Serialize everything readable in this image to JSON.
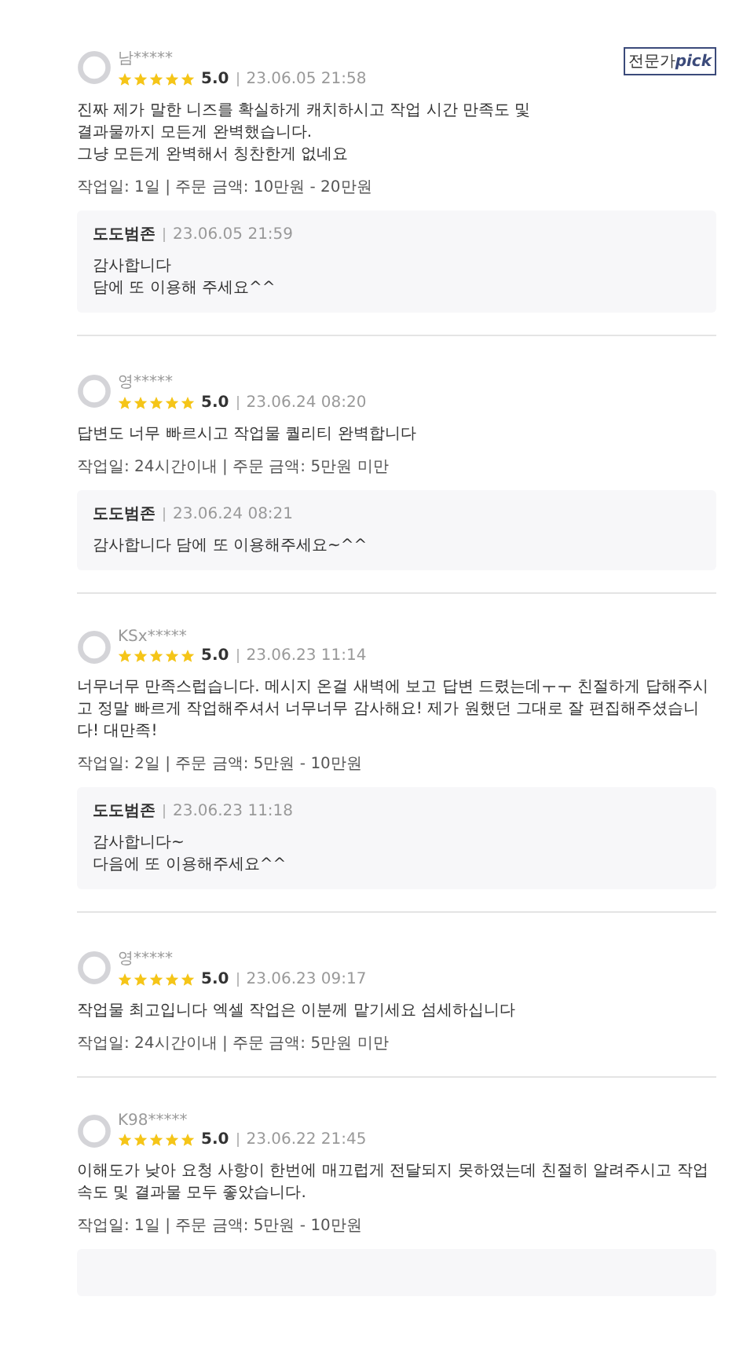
{
  "reviews": [
    {
      "user": "남*****",
      "stars": 5,
      "rating": "5.0",
      "date": "23.06.05 21:58",
      "badge": "전문가**pick**",
      "text": "진짜 제가 말한 니즈를 확실하게 캐치하시고 작업 시간 만족도 및\n결과물까지 모든게 완벽했습니다.\n그냥 모든게 완벽해서 칭찬한게 없네요",
      "meta": "작업일: 1일 | 주문 금액: 10만원 - 20만원",
      "reply": {
        "author": "도도범존",
        "date": "23.06.05 21:59",
        "text": "감사합니다\n담에 또 이용해 주세요^^"
      }
    },
    {
      "user": "영*****",
      "stars": 5,
      "rating": "5.0",
      "date": "23.06.24 08:20",
      "text": "답변도 너무 빠르시고 작업물 퀄리티 완벽합니다",
      "meta": "작업일: 24시간이내 | 주문 금액: 5만원 미만",
      "reply": {
        "author": "도도범존",
        "date": "23.06.24 08:21",
        "text": "감사합니다 담에 또 이용해주세요~^^"
      }
    },
    {
      "user": "KSx*****",
      "stars": 5,
      "rating": "5.0",
      "date": "23.06.23 11:14",
      "text": "너무너무 만족스럽습니다. 메시지 온걸 새벽에 보고 답변 드렸는데ㅜㅜ 친절하게 답해주시고 정말 빠르게 작업해주셔서 너무너무 감사해요! 제가 원했던 그대로 잘 편집해주셨습니다! 대만족!",
      "meta": "작업일: 2일 | 주문 금액: 5만원 - 10만원",
      "reply": {
        "author": "도도범존",
        "date": "23.06.23 11:18",
        "text": "감사합니다~\n다음에 또 이용해주세요^^"
      }
    },
    {
      "user": "영*****",
      "stars": 5,
      "rating": "5.0",
      "date": "23.06.23 09:17",
      "text": "작업물 최고입니다 엑셀 작업은 이분께 맡기세요 섬세하십니다",
      "meta": "작업일: 24시간이내 | 주문 금액: 5만원 미만"
    },
    {
      "user": "K98*****",
      "stars": 5,
      "rating": "5.0",
      "date": "23.06.22 21:45",
      "text": "이해도가 낮아 요청 사항이 한번에 매끄럽게 전달되지 못하였는데 친절히 알려주시고 작업속도 및 결과물 모두 좋았습니다.",
      "meta": "작업일: 1일 | 주문 금액: 5만원 - 10만원",
      "reply_box": true
    }
  ]
}
